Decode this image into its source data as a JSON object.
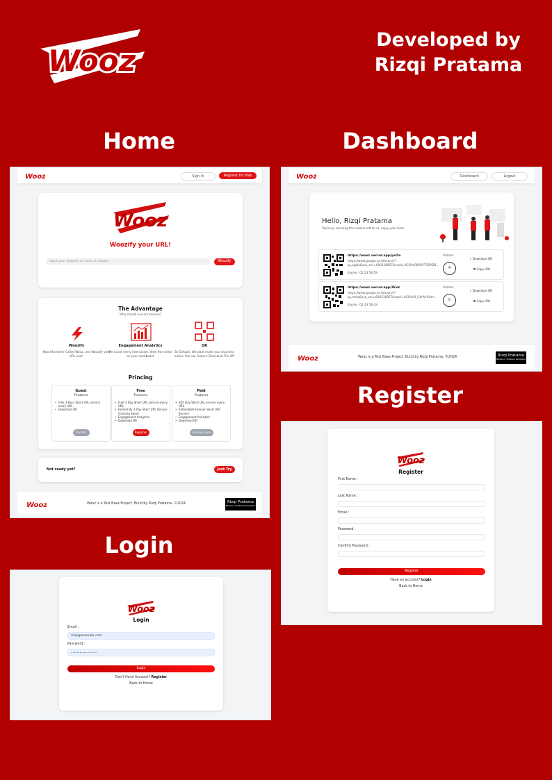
{
  "brand": {
    "name": "Wooz",
    "accent": "#e01515",
    "background": "#b00000"
  },
  "developer": {
    "line1": "Developed by",
    "line2": "Rizqi Pratama"
  },
  "sections": {
    "home": "Home",
    "dashboard": "Dashboard",
    "register": "Register",
    "login": "Login"
  },
  "home": {
    "nav": {
      "signin": "Sign In",
      "register": "Register for free"
    },
    "hero": {
      "tagline": "Woozify your URL!",
      "url_placeholder": "Input your website url make it woozie",
      "button": "Woozify"
    },
    "advantage": {
      "title": "The Advantage",
      "subtitle": "Why should use our service?",
      "items": [
        {
          "icon": "lightning-icon",
          "title": "Woozify",
          "desc": "Now Shortener Called Wooz, and Woozify your URL now!"
        },
        {
          "icon": "analytics-chart-icon",
          "title": "Engagement Analytics",
          "desc": "We count every interaction. View the visitor on your dashboard"
        },
        {
          "icon": "qr-code-icon",
          "title": "QR",
          "desc": "By Default, We want make your business easier. Use our feature Download The QR"
        }
      ]
    },
    "pricing": {
      "title": "Princing",
      "plans": [
        {
          "name": "Guest",
          "features_label": "Features",
          "features": [
            "Free 3 Hour Short URL service every URL",
            "Download QR"
          ],
          "button": "Current",
          "button_color": "#9ca3af"
        },
        {
          "name": "Free",
          "features_label": "Features",
          "features": [
            "Free 3 Day Short URL service every URL",
            "Extend By 3 Day Short URL Service (Coming Soon)",
            "Engagement Analytics",
            "Download QR"
          ],
          "button": "Register",
          "button_color": "#e01515"
        },
        {
          "name": "Paid",
          "features_label": "Features",
          "features": [
            "365 Day Short URL service every URL",
            "Extendable Forever Short URL Service",
            "Engagement Analytics",
            "Download QR"
          ],
          "button": "Coming Soon",
          "button_color": "#9ca3af"
        }
      ]
    },
    "cta": {
      "text": "Not ready yet?",
      "button": "Just Try"
    }
  },
  "footer": {
    "text": "Wooz is a Test Base Project. Build by Rizqi Pratama. ©2024",
    "badge_title": "Rizqi Pratama",
    "badge_sub": "Backend | Software Developer"
  },
  "dashboard": {
    "nav": {
      "dashboard": "Dashboard",
      "logout": "Logout"
    },
    "greeting": "Hello, Rizqi Pratama",
    "subtext": "Too busy counting the visitors left to us, enjoy your time.",
    "links": [
      {
        "short": "https://wooz.vercel.app/yw5a",
        "long": "https://www.google.co.id/search?q=apple&sca_esv=600316857&sxsrf=ACQVn0BABYTRZMZ8...",
        "expire": "Expire : 02:23:58:59",
        "visitors_label": "Visitors",
        "visitors": 4,
        "download": "Download QR",
        "copy": "Copy URL"
      },
      {
        "short": "https://wooz.vercel.app/3Evk",
        "long": "https://www.google.co.id/search?q=meta&sca_esv=600316857&sxsrf=ACQVn0_CdHVrVQm...",
        "expire": "Expire : 02:23:58:43",
        "visitors_label": "Visitors",
        "visitors": 0,
        "download": "Download QR",
        "copy": "Copy URL"
      }
    ]
  },
  "register": {
    "title": "Register",
    "fields": [
      "First Name :",
      "Last Name :",
      "Email :",
      "Password :",
      "Confirm Password :"
    ],
    "button": "Register",
    "have_account": "Have an account?",
    "login_link": "Login",
    "back": "Back to Home"
  },
  "login": {
    "title": "Login",
    "email_label": "Email :",
    "email_value": "rizqi@example.com",
    "password_label": "Password :",
    "password_value": "••••••••••••••••••",
    "button": "Login",
    "no_account": "Don't Have Account?",
    "register_link": "Register",
    "back": "Back to Home"
  }
}
